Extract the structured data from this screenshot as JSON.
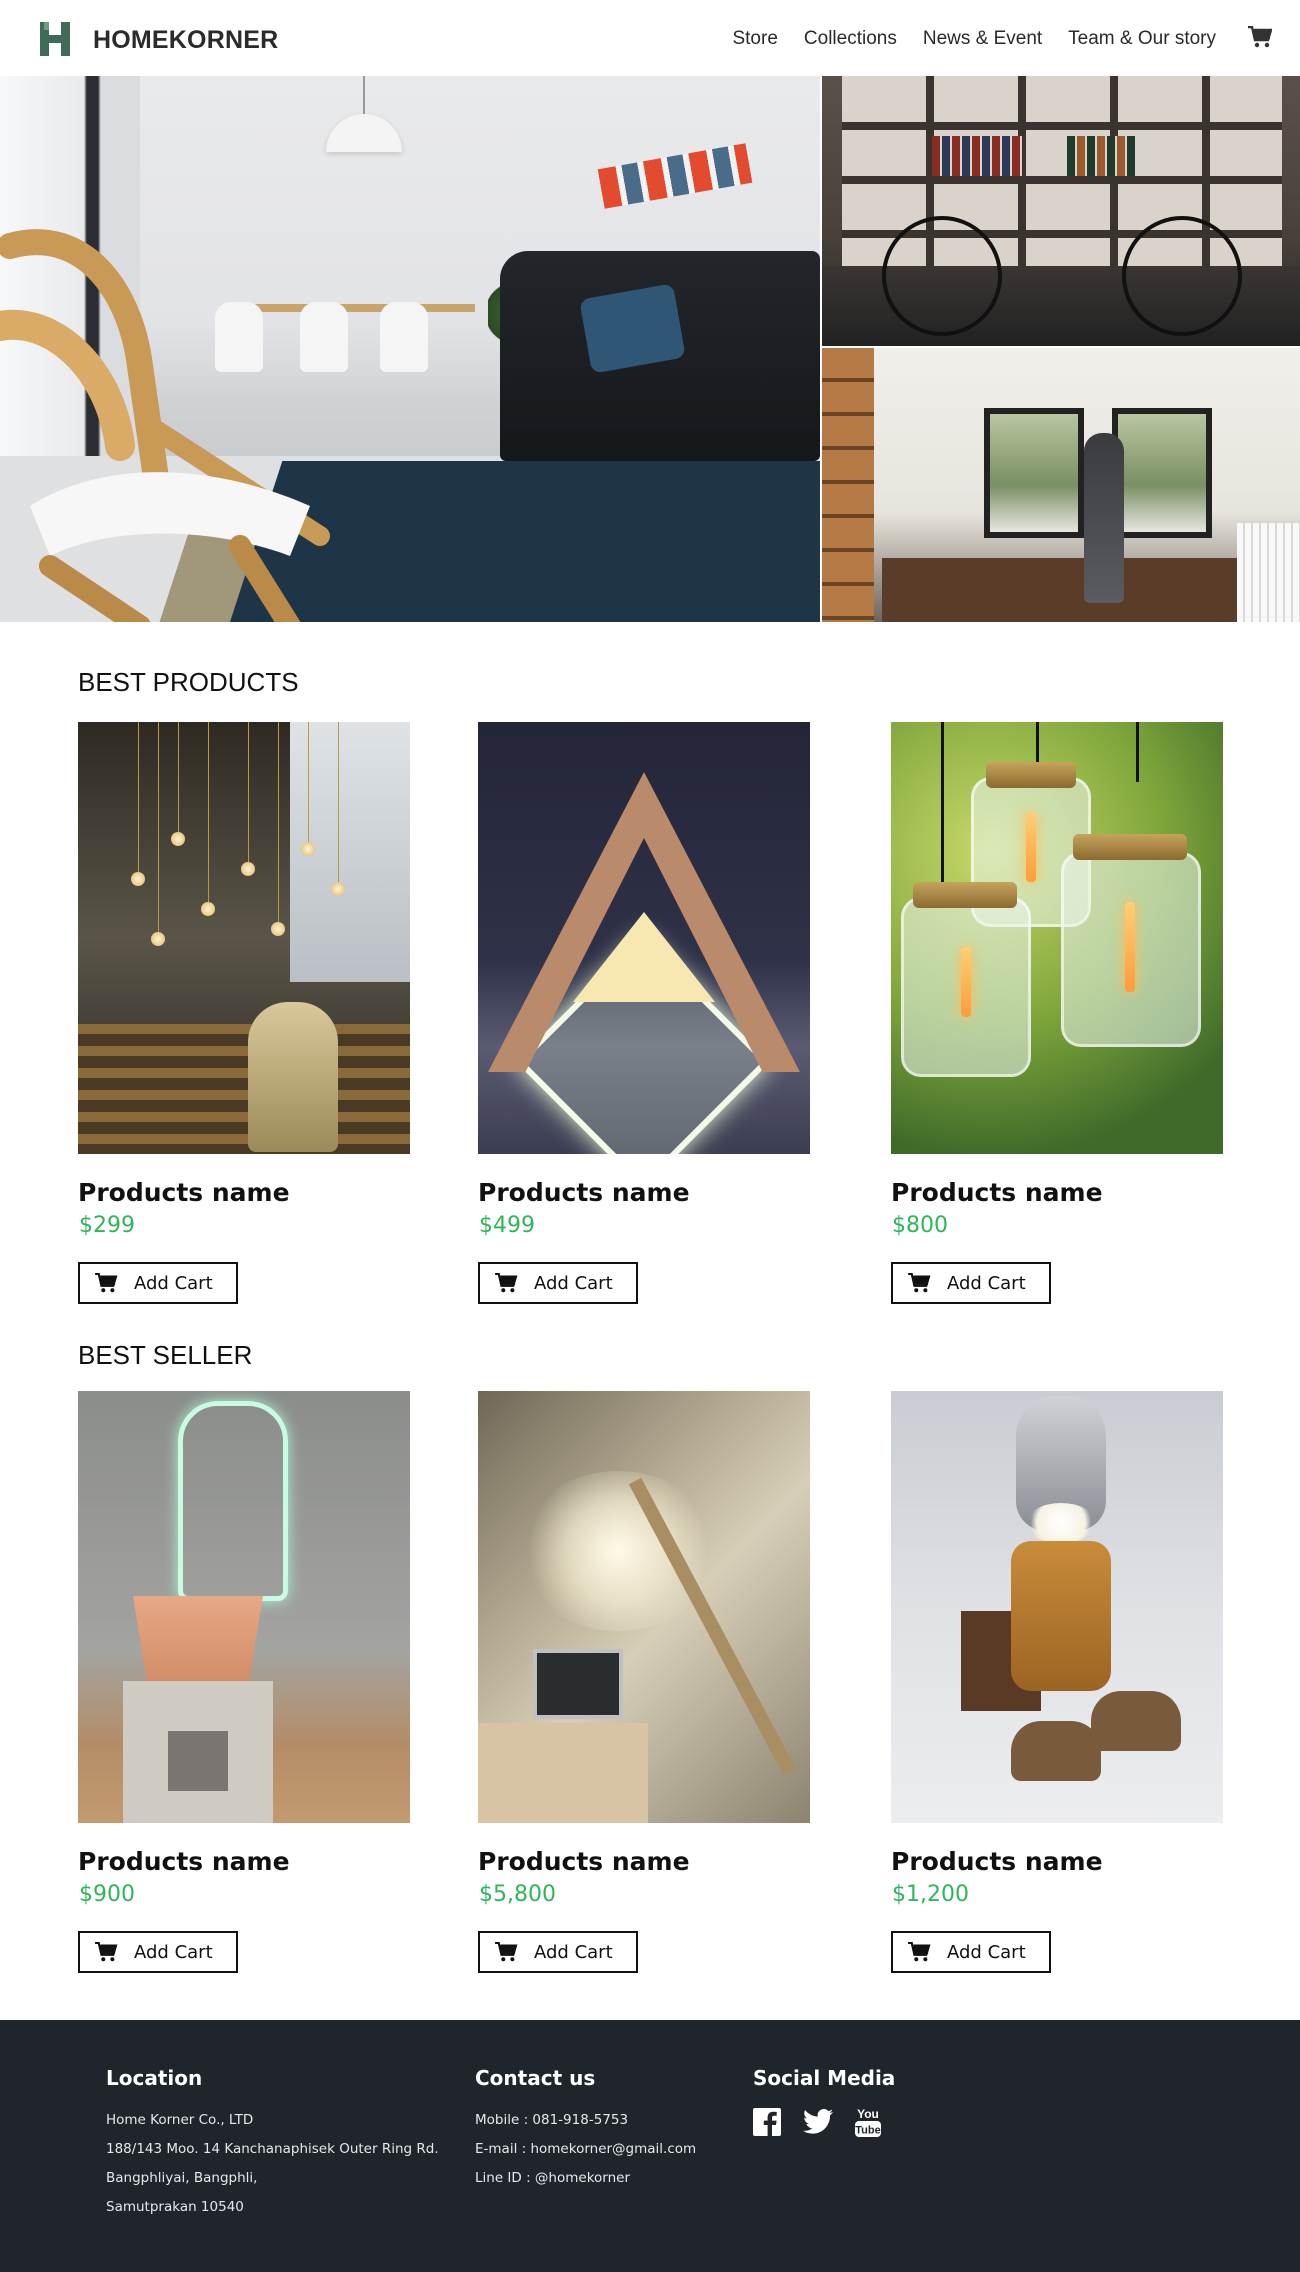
{
  "header": {
    "brand": "HOMEKORNER",
    "nav": [
      "Store",
      "Collections",
      "News & Event",
      "Team & Our story"
    ],
    "cart_icon": "cart-icon",
    "logo_color": "#3f6b57"
  },
  "sections": [
    {
      "title": "BEST PRODUCTS",
      "products": [
        {
          "name": "Products name",
          "price": "$299",
          "button": "Add Cart"
        },
        {
          "name": "Products name",
          "price": "$499",
          "button": "Add Cart"
        },
        {
          "name": "Products name",
          "price": "$800",
          "button": "Add Cart"
        }
      ]
    },
    {
      "title": "BEST SELLER",
      "products": [
        {
          "name": "Products name",
          "price": "$900",
          "button": "Add Cart"
        },
        {
          "name": "Products name",
          "price": "$5,800",
          "button": "Add Cart"
        },
        {
          "name": "Products name",
          "price": "$1,200",
          "button": "Add Cart"
        }
      ]
    }
  ],
  "footer": {
    "location": {
      "title": "Location",
      "lines": [
        "Home Korner Co., LTD",
        "188/143 Moo. 14 Kanchanaphisek Outer Ring Rd.",
        "Bangphliyai, Bangphli,",
        "Samutprakan 10540"
      ]
    },
    "contact": {
      "title": "Contact us",
      "lines": [
        "Mobile : 081-918-5753",
        "E-mail : homekorner@gmail.com",
        "Line ID : @homekorner"
      ]
    },
    "social": {
      "title": "Social Media",
      "icons": [
        "facebook-icon",
        "twitter-icon",
        "youtube-icon"
      ]
    }
  },
  "colors": {
    "price": "#2fb55a",
    "footer_bg": "#1f252b"
  }
}
